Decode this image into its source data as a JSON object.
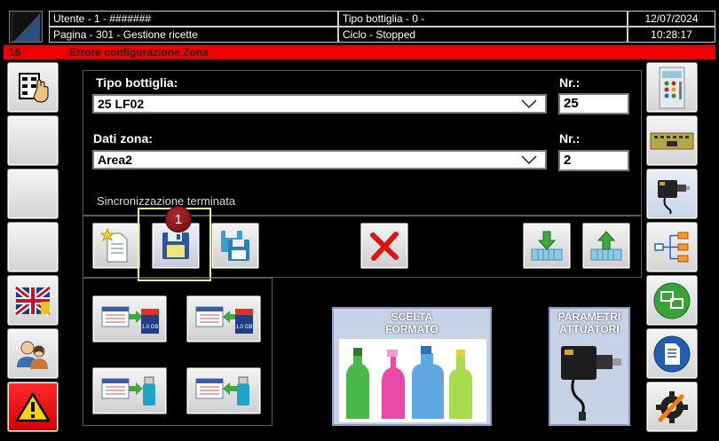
{
  "header": {
    "user": "Utente - 1 - #######",
    "page": "Pagina - 301 - Gestione ricette",
    "bottle_type": "Tipo bottiglia - 0 -",
    "cycle": "Ciclo - Stopped",
    "date": "12/07/2024",
    "time": "10:28:17"
  },
  "error": {
    "code": "16",
    "message": "Errore configurazione Zona"
  },
  "form": {
    "bottle_label": "Tipo bottiglia:",
    "bottle_value": "25 LF02",
    "bottle_nr_label": "Nr.:",
    "bottle_nr": "25",
    "zone_label": "Dati zona:",
    "zone_value": "Area2",
    "zone_nr_label": "Nr.:",
    "zone_nr": "2",
    "status": "Sincronizzazione terminata"
  },
  "annotation": {
    "badge": "1"
  },
  "media": {
    "sd_label": "1.0 GB"
  },
  "buttons": {
    "format": "SCELTA FORMATO",
    "actuators": "PARAMETRI ATTUATORI"
  },
  "colors": {
    "error_bar": "#ee0000",
    "highlight": "#f3ef9d",
    "badge": "#8b1a1a"
  }
}
